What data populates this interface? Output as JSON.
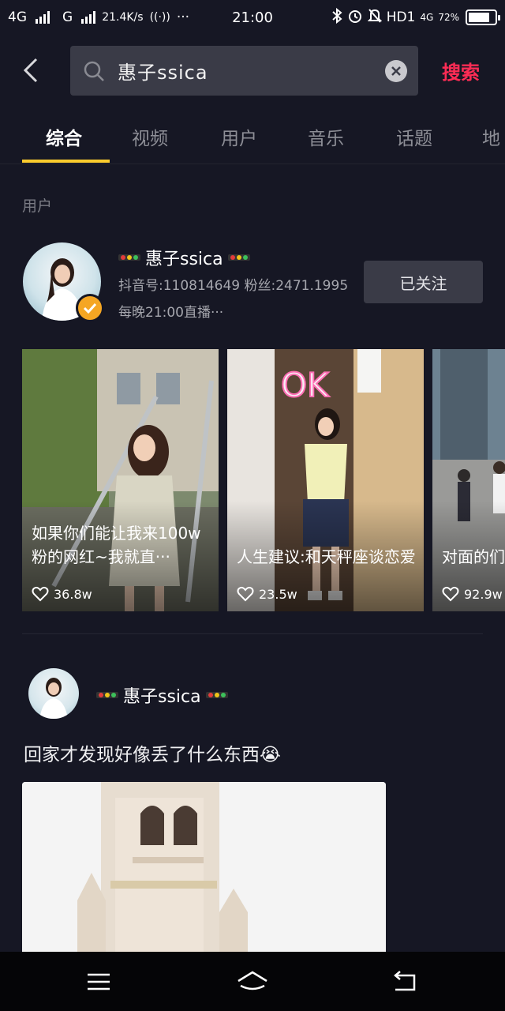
{
  "status_bar": {
    "network_1": "4G",
    "network_2": "G",
    "speed": "21.4K/s",
    "signal_icon": "wifi-calling-icon",
    "more": "···",
    "time": "21:00",
    "hd": "HD1",
    "lte": "4G",
    "battery": "72%",
    "battery_level": 0.72
  },
  "search": {
    "query": "惠子ssica",
    "action_label": "搜索",
    "accent_color": "#fe2c55"
  },
  "tabs": [
    {
      "label": "综合",
      "active": true
    },
    {
      "label": "视频",
      "active": false
    },
    {
      "label": "用户",
      "active": false
    },
    {
      "label": "音乐",
      "active": false
    },
    {
      "label": "话题",
      "active": false
    },
    {
      "label": "地",
      "active": false
    }
  ],
  "user_section": {
    "label": "用户",
    "user": {
      "name": "惠子ssica",
      "meta": "抖音号:110814649 粉丝:2471.1995",
      "bio": "每晚21:00直播···",
      "follow_label": "已关注"
    }
  },
  "videos": [
    {
      "caption": "如果你们能让我来100w粉的网红~我就直···",
      "likes": "36.8w"
    },
    {
      "caption": "人生建议:和天秤座谈恋爱",
      "likes": "23.5w"
    },
    {
      "caption": "对面的们~哼!",
      "likes": "92.9w"
    }
  ],
  "post": {
    "username": "惠子ssica",
    "text": "回家才发现好像丢了什么东西😭"
  },
  "colors": {
    "background": "#161724",
    "tab_indicator": "#fbcb2d",
    "verified": "#f5a623"
  }
}
